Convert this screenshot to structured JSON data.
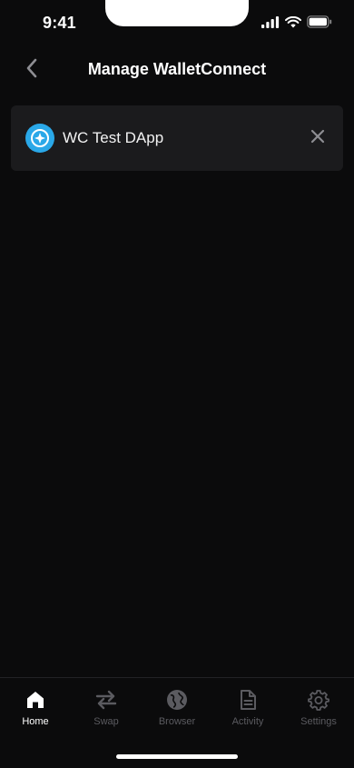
{
  "status_bar": {
    "time": "9:41",
    "icons": [
      "cellular-signal-icon",
      "wifi-icon",
      "battery-icon"
    ]
  },
  "header": {
    "title": "Manage WalletConnect",
    "back_icon": "chevron-left-icon"
  },
  "sessions": [
    {
      "name": "WC Test DApp",
      "icon": "dapp-compass-icon",
      "close_icon": "close-icon"
    }
  ],
  "tab_bar": {
    "tabs": [
      {
        "label": "Home",
        "icon": "home-icon",
        "active": true
      },
      {
        "label": "Swap",
        "icon": "swap-icon",
        "active": false
      },
      {
        "label": "Browser",
        "icon": "globe-icon",
        "active": false
      },
      {
        "label": "Activity",
        "icon": "document-icon",
        "active": false
      },
      {
        "label": "Settings",
        "icon": "gear-icon",
        "active": false
      }
    ]
  },
  "colors": {
    "background": "#0b0b0c",
    "card": "#1b1b1d",
    "accent": "#2aa8e8",
    "inactive": "#5b5b60",
    "active": "#ffffff"
  }
}
